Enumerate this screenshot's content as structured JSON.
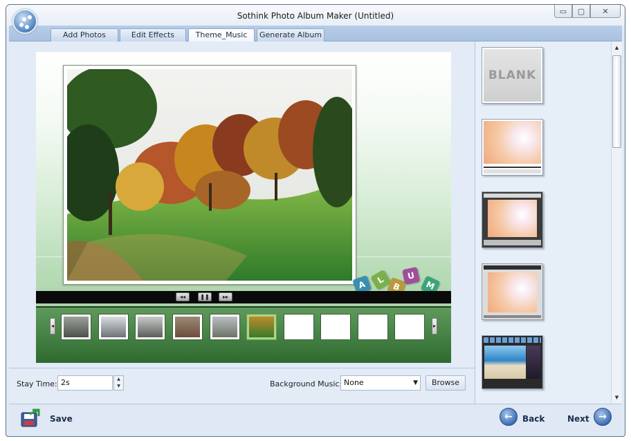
{
  "window": {
    "title": "Sothink Photo Album Maker (Untitled)",
    "minimize_glyph": "▭",
    "maximize_glyph": "▢",
    "close_glyph": "✕"
  },
  "tabs": [
    {
      "label": "Add Photos",
      "active": false
    },
    {
      "label": "Edit Effects",
      "active": false
    },
    {
      "label": "Theme_Music",
      "active": true
    },
    {
      "label": "Generate Album",
      "active": false
    }
  ],
  "preview": {
    "album_letters": [
      "A",
      "L",
      "B",
      "U",
      "M"
    ],
    "controls": {
      "rewind": "◂◂",
      "pause": "❚❚",
      "forward": "▸▸"
    },
    "thumbnails": [
      {
        "filled": true,
        "selected": false
      },
      {
        "filled": true,
        "selected": false
      },
      {
        "filled": true,
        "selected": false
      },
      {
        "filled": true,
        "selected": false
      },
      {
        "filled": true,
        "selected": false
      },
      {
        "filled": true,
        "selected": true
      },
      {
        "filled": false,
        "selected": false
      },
      {
        "filled": false,
        "selected": false
      },
      {
        "filled": false,
        "selected": false
      },
      {
        "filled": false,
        "selected": false
      }
    ],
    "strip_prev": "◂",
    "strip_next": "▸"
  },
  "settings": {
    "stay_time_label": "Stay Time:",
    "stay_time_value": "2s",
    "background_music_label": "Background Music:",
    "background_music_value": "None",
    "browse_label": "Browse"
  },
  "themes": [
    {
      "name": "BLANK"
    },
    {
      "name": ""
    },
    {
      "name": ""
    },
    {
      "name": ""
    },
    {
      "name": ""
    }
  ],
  "footer": {
    "save_label": "Save",
    "back_label": "Back",
    "next_label": "Next"
  },
  "colors": {
    "accent": "#3e6fb5",
    "stage_green": "#95c694",
    "strip_green": "#2e6a2e",
    "selected_thumb": "#a9d68b"
  }
}
